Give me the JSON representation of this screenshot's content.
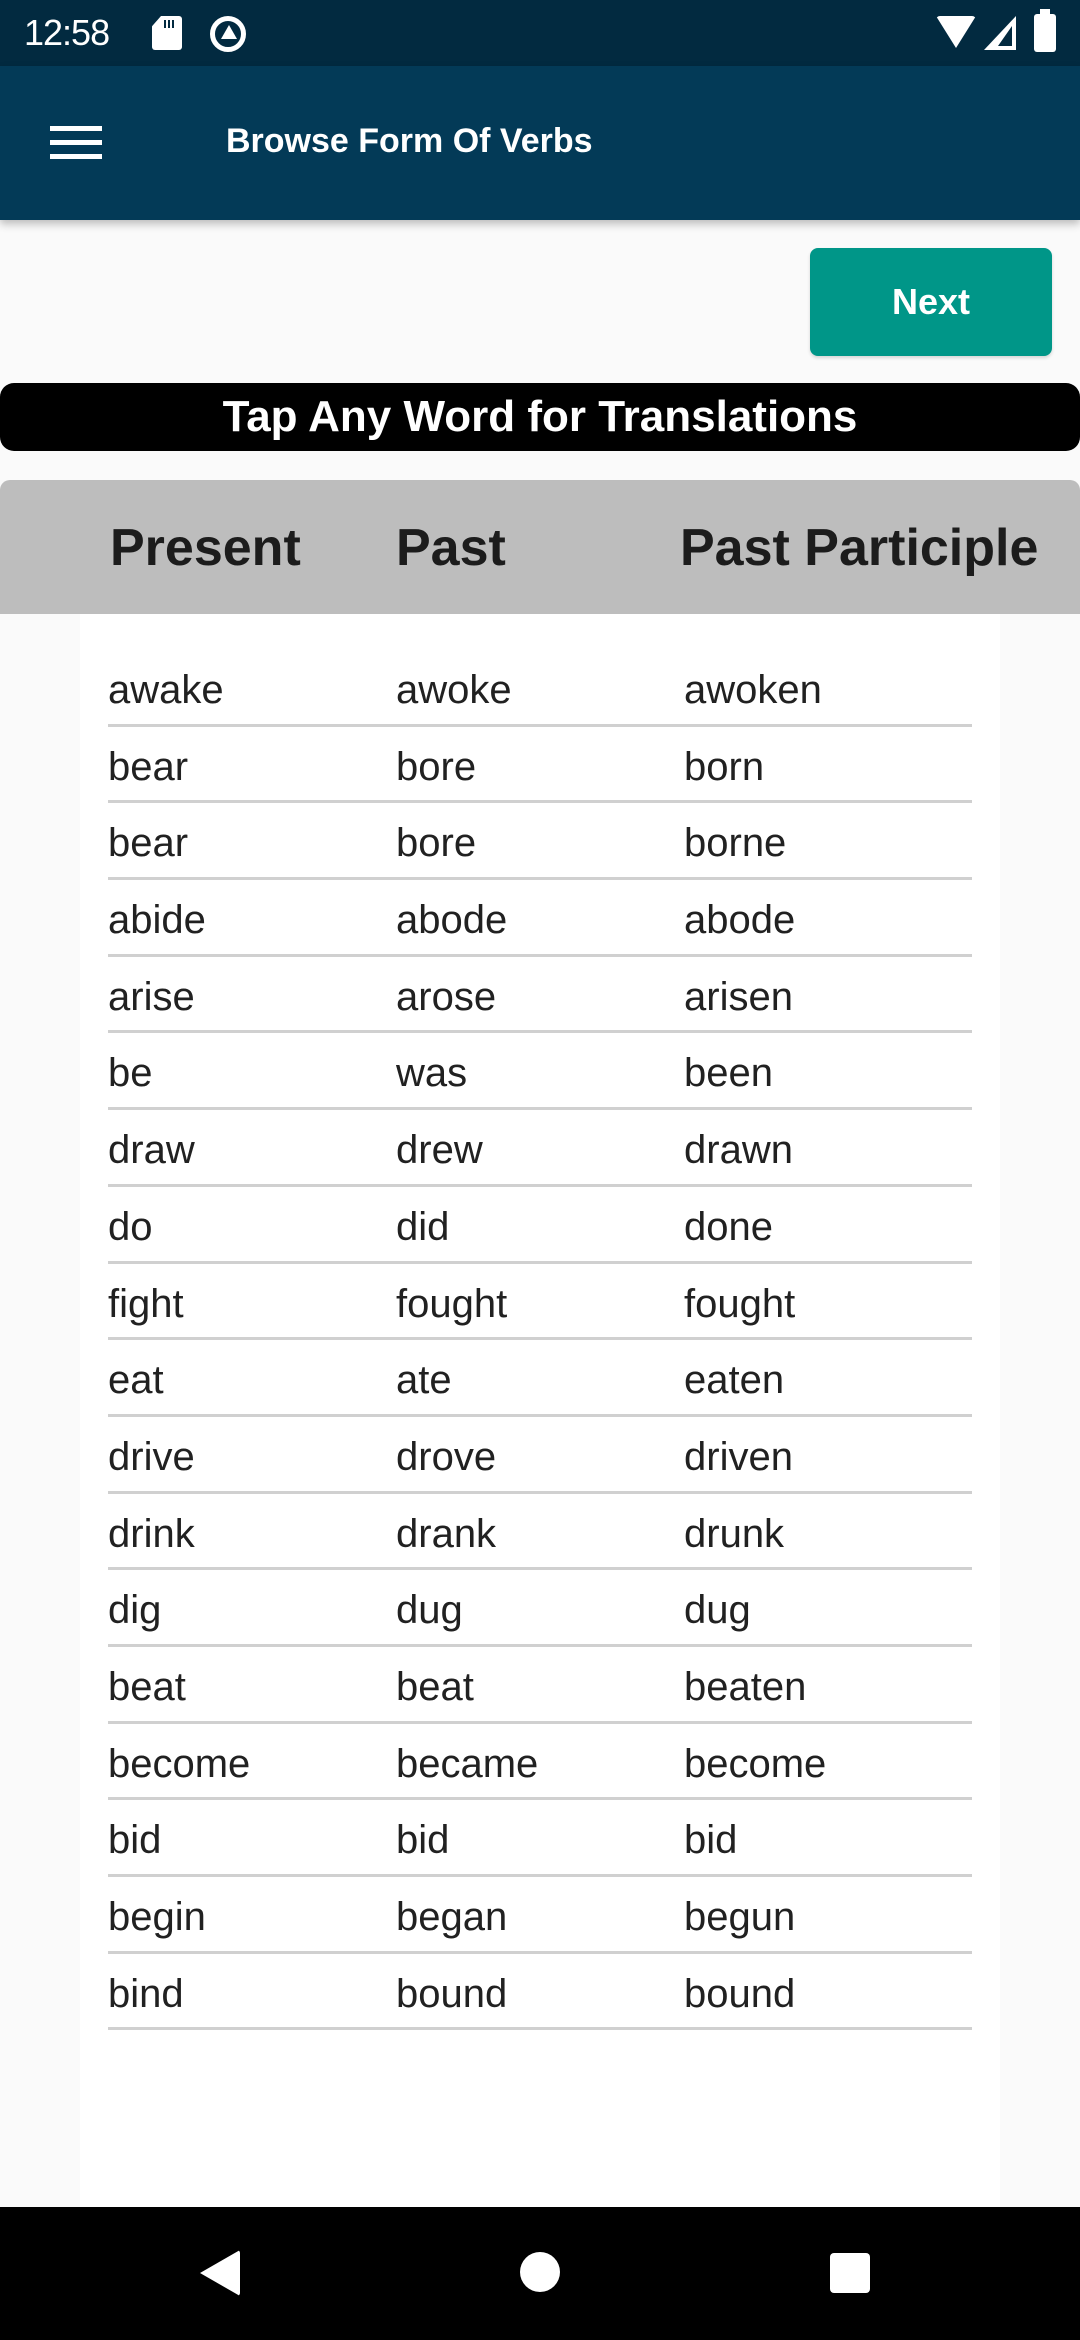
{
  "status_bar": {
    "time": "12:58",
    "icons": [
      "sd-card-icon",
      "app-notification-icon",
      "wifi-icon",
      "cell-signal-icon",
      "battery-icon"
    ]
  },
  "app_bar": {
    "menu_icon": "hamburger-menu-icon",
    "title": "Browse Form Of Verbs"
  },
  "next_button": {
    "label": "Next",
    "color": "#009688"
  },
  "banner": {
    "text": "Tap Any Word for Translations"
  },
  "table": {
    "headers": [
      "Present",
      "Past",
      "Past Participle"
    ],
    "rows": [
      [
        "awake",
        "awoke",
        "awoken"
      ],
      [
        "bear",
        "bore",
        "born"
      ],
      [
        "bear",
        "bore",
        "borne"
      ],
      [
        "abide",
        "abode",
        "abode"
      ],
      [
        "arise",
        "arose",
        "arisen"
      ],
      [
        "be",
        "was",
        "been"
      ],
      [
        "draw",
        "drew",
        "drawn"
      ],
      [
        "do",
        "did",
        "done"
      ],
      [
        "fight",
        "fought",
        "fought"
      ],
      [
        "eat",
        "ate",
        "eaten"
      ],
      [
        "drive",
        "drove",
        "driven"
      ],
      [
        "drink",
        "drank",
        "drunk"
      ],
      [
        "dig",
        "dug",
        "dug"
      ],
      [
        "beat",
        "beat",
        "beaten"
      ],
      [
        "become",
        "became",
        "become"
      ],
      [
        "bid",
        "bid",
        "bid"
      ],
      [
        "begin",
        "began",
        "begun"
      ],
      [
        "bind",
        "bound",
        "bound"
      ]
    ]
  },
  "colors": {
    "status_bar": "#022a40",
    "app_bar": "#033a57",
    "accent": "#009688",
    "header_bg": "#bdbdbd"
  },
  "nav_bar": {
    "icons": [
      "back-icon",
      "home-icon",
      "recents-icon"
    ]
  }
}
